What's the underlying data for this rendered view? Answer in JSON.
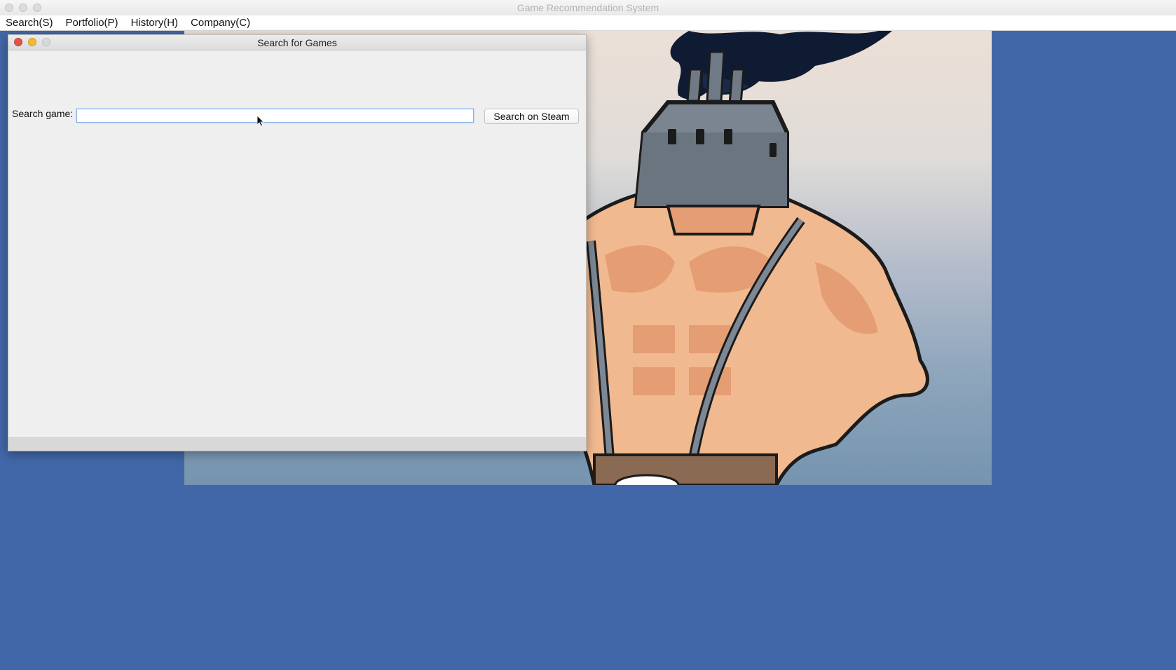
{
  "app": {
    "title": "Game Recommendation System"
  },
  "menubar": {
    "items": [
      {
        "label": "Search(S)"
      },
      {
        "label": "Portfolio(P)"
      },
      {
        "label": "History(H)"
      },
      {
        "label": "Company(C)"
      }
    ]
  },
  "search_window": {
    "title": "Search for Games",
    "search_label": "Search game:",
    "search_value": "",
    "search_button_label": "Search on Steam"
  },
  "colors": {
    "desktop_background": "#4267a8",
    "close_dot": "#e0524a",
    "minimize_dot": "#f2b931"
  },
  "icons": {
    "backdrop_art": "muscular-factory-head-illustration",
    "cursor": "mouse-pointer-icon"
  }
}
